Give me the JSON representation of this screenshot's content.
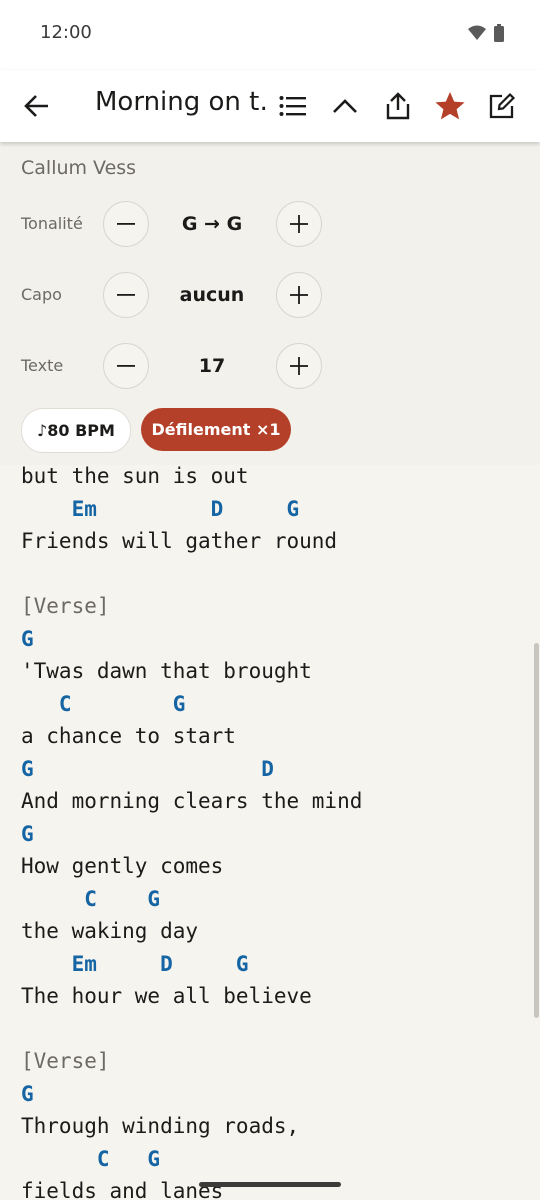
{
  "status": {
    "time": "12:00",
    "icons": [
      "wifi-icon",
      "battery-icon"
    ]
  },
  "app_bar": {
    "title": "Morning on t…",
    "icons": [
      "back-arrow-icon",
      "list-icon",
      "chevron-up-icon",
      "share-icon",
      "star-icon",
      "edit-icon"
    ],
    "star_color": "#b5402a"
  },
  "song": {
    "artist": "Callum Vess"
  },
  "controls": {
    "key": {
      "label": "Tonalité",
      "value": "G → G"
    },
    "capo": {
      "label": "Capo",
      "value": "aucun"
    },
    "text": {
      "label": "Texte",
      "value": "17"
    }
  },
  "pills": {
    "bpm": "♪80 BPM",
    "scroll": "Défilement ×1"
  },
  "colors": {
    "chord": "#1565a5",
    "accent": "#b5402a",
    "background": "#f6f4ef"
  },
  "lyrics": [
    {
      "t": "lyric",
      "s": "but the sun is out"
    },
    {
      "t": "chord",
      "s": "    Em         D     G"
    },
    {
      "t": "lyric",
      "s": "Friends will gather round"
    },
    {
      "t": "blank",
      "s": ""
    },
    {
      "t": "section",
      "s": "[Verse]"
    },
    {
      "t": "chord",
      "s": "G"
    },
    {
      "t": "lyric",
      "s": "'Twas dawn that brought"
    },
    {
      "t": "chord",
      "s": "   C        G"
    },
    {
      "t": "lyric",
      "s": "a chance to start"
    },
    {
      "t": "chord",
      "s": "G                  D"
    },
    {
      "t": "lyric",
      "s": "And morning clears the mind"
    },
    {
      "t": "chord",
      "s": "G"
    },
    {
      "t": "lyric",
      "s": "How gently comes"
    },
    {
      "t": "chord",
      "s": "     C    G"
    },
    {
      "t": "lyric",
      "s": "the waking day"
    },
    {
      "t": "chord",
      "s": "    Em     D     G"
    },
    {
      "t": "lyric",
      "s": "The hour we all believe"
    },
    {
      "t": "blank",
      "s": ""
    },
    {
      "t": "section",
      "s": "[Verse]"
    },
    {
      "t": "chord",
      "s": "G"
    },
    {
      "t": "lyric",
      "s": "Through winding roads,"
    },
    {
      "t": "chord",
      "s": "      C   G"
    },
    {
      "t": "lyric",
      "s": "fields and lanes"
    }
  ]
}
